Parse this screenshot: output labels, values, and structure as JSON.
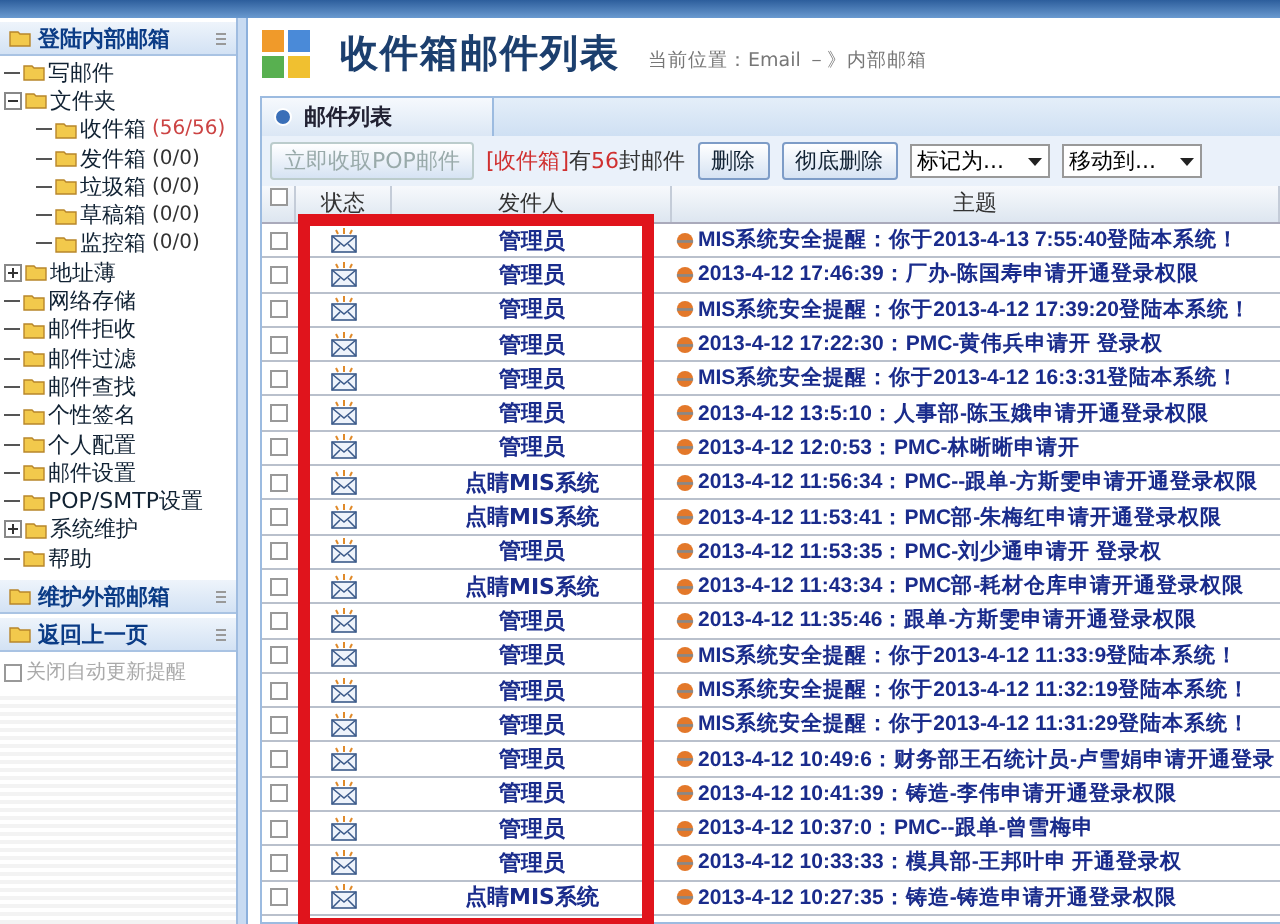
{
  "sidebar": {
    "sections": [
      {
        "title": "登陆内部邮箱",
        "tree": [
          {
            "label": "写邮件"
          },
          {
            "label": "文件夹",
            "expanded": true,
            "children": [
              {
                "label": "收件箱",
                "count": "(56/56)",
                "unread": true
              },
              {
                "label": "发件箱",
                "count": "(0/0)",
                "unread": false
              },
              {
                "label": "垃圾箱",
                "count": "(0/0)",
                "unread": false
              },
              {
                "label": "草稿箱",
                "count": "(0/0)",
                "unread": false
              },
              {
                "label": "监控箱",
                "count": "(0/0)",
                "unread": false
              }
            ]
          },
          {
            "label": "地址薄",
            "expanded": false
          },
          {
            "label": "网络存储"
          },
          {
            "label": "邮件拒收"
          },
          {
            "label": "邮件过滤"
          },
          {
            "label": "邮件查找"
          },
          {
            "label": "个性签名"
          },
          {
            "label": "个人配置"
          },
          {
            "label": "邮件设置"
          },
          {
            "label": "POP/SMTP设置"
          },
          {
            "label": "系统维护",
            "expanded": false
          },
          {
            "label": "帮助"
          }
        ]
      },
      {
        "title": "维护外部邮箱"
      },
      {
        "title": "返回上一页"
      }
    ],
    "option": {
      "label": "关闭自动更新提醒",
      "checked": false,
      "disabled": true
    }
  },
  "page": {
    "title": "收件箱邮件列表",
    "location": "当前位置：Email －》内部邮箱"
  },
  "panel": {
    "tab": "邮件列表",
    "toolbar": {
      "fetch_button": {
        "label": "立即收取POP邮件",
        "disabled": true
      },
      "summary": [
        {
          "text": "[收件箱]",
          "highlight": true
        },
        {
          "text": "有",
          "highlight": false
        },
        {
          "text": "56",
          "highlight": true
        },
        {
          "text": "封邮件",
          "highlight": false
        }
      ],
      "buttons": [
        "删除",
        "彻底删除"
      ],
      "selects": [
        "标记为...",
        "移动到..."
      ]
    },
    "table": {
      "select_all_checked": false,
      "columns": [
        "状态",
        "发件人",
        "主题"
      ],
      "rows": [
        {
          "checked": false,
          "sender": "管理员",
          "subject": "MIS系统安全提醒：你于2013-4-13 7:55:40登陆本系统！"
        },
        {
          "checked": false,
          "sender": "管理员",
          "subject": "2013-4-12 17:46:39：厂办-陈国寿申请开通登录权限"
        },
        {
          "checked": false,
          "sender": "管理员",
          "subject": "MIS系统安全提醒：你于2013-4-12 17:39:20登陆本系统！"
        },
        {
          "checked": false,
          "sender": "管理员",
          "subject": "2013-4-12 17:22:30：PMC-黄伟兵申请开 登录权"
        },
        {
          "checked": false,
          "sender": "管理员",
          "subject": "MIS系统安全提醒：你于2013-4-12 16:3:31登陆本系统！"
        },
        {
          "checked": false,
          "sender": "管理员",
          "subject": "2013-4-12 13:5:10：人事部-陈玉娥申请开通登录权限"
        },
        {
          "checked": false,
          "sender": "管理员",
          "subject": "2013-4-12 12:0:53：PMC-林晰晰申请开"
        },
        {
          "checked": false,
          "sender": "点睛MIS系统",
          "subject": "2013-4-12 11:56:34：PMC--跟单-方斯雯申请开通登录权限"
        },
        {
          "checked": false,
          "sender": "点睛MIS系统",
          "subject": "2013-4-12 11:53:41：PMC部-朱梅红申请开通登录权限"
        },
        {
          "checked": false,
          "sender": "管理员",
          "subject": "2013-4-12 11:53:35：PMC-刘少通申请开 登录权"
        },
        {
          "checked": false,
          "sender": "点睛MIS系统",
          "subject": "2013-4-12 11:43:34：PMC部-耗材仓库申请开通登录权限"
        },
        {
          "checked": false,
          "sender": "管理员",
          "subject": "2013-4-12 11:35:46：跟单-方斯雯申请开通登录权限"
        },
        {
          "checked": false,
          "sender": "管理员",
          "subject": "MIS系统安全提醒：你于2013-4-12 11:33:9登陆本系统！"
        },
        {
          "checked": false,
          "sender": "管理员",
          "subject": "MIS系统安全提醒：你于2013-4-12 11:32:19登陆本系统！"
        },
        {
          "checked": false,
          "sender": "管理员",
          "subject": "MIS系统安全提醒：你于2013-4-12 11:31:29登陆本系统！"
        },
        {
          "checked": false,
          "sender": "管理员",
          "subject": "2013-4-12 10:49:6：财务部王石统计员-卢雪娟申请开通登录"
        },
        {
          "checked": false,
          "sender": "管理员",
          "subject": "2013-4-12 10:41:39：铸造-李伟申请开通登录权限"
        },
        {
          "checked": false,
          "sender": "管理员",
          "subject": "2013-4-12 10:37:0：PMC--跟单-曾雪梅申"
        },
        {
          "checked": false,
          "sender": "管理员",
          "subject": "2013-4-12 10:33:33：模具部-王邦叶申 开通登录权"
        },
        {
          "checked": false,
          "sender": "点睛MIS系统",
          "subject": "2013-4-12 10:27:35：铸造-铸造申请开通登录权限"
        }
      ]
    }
  }
}
